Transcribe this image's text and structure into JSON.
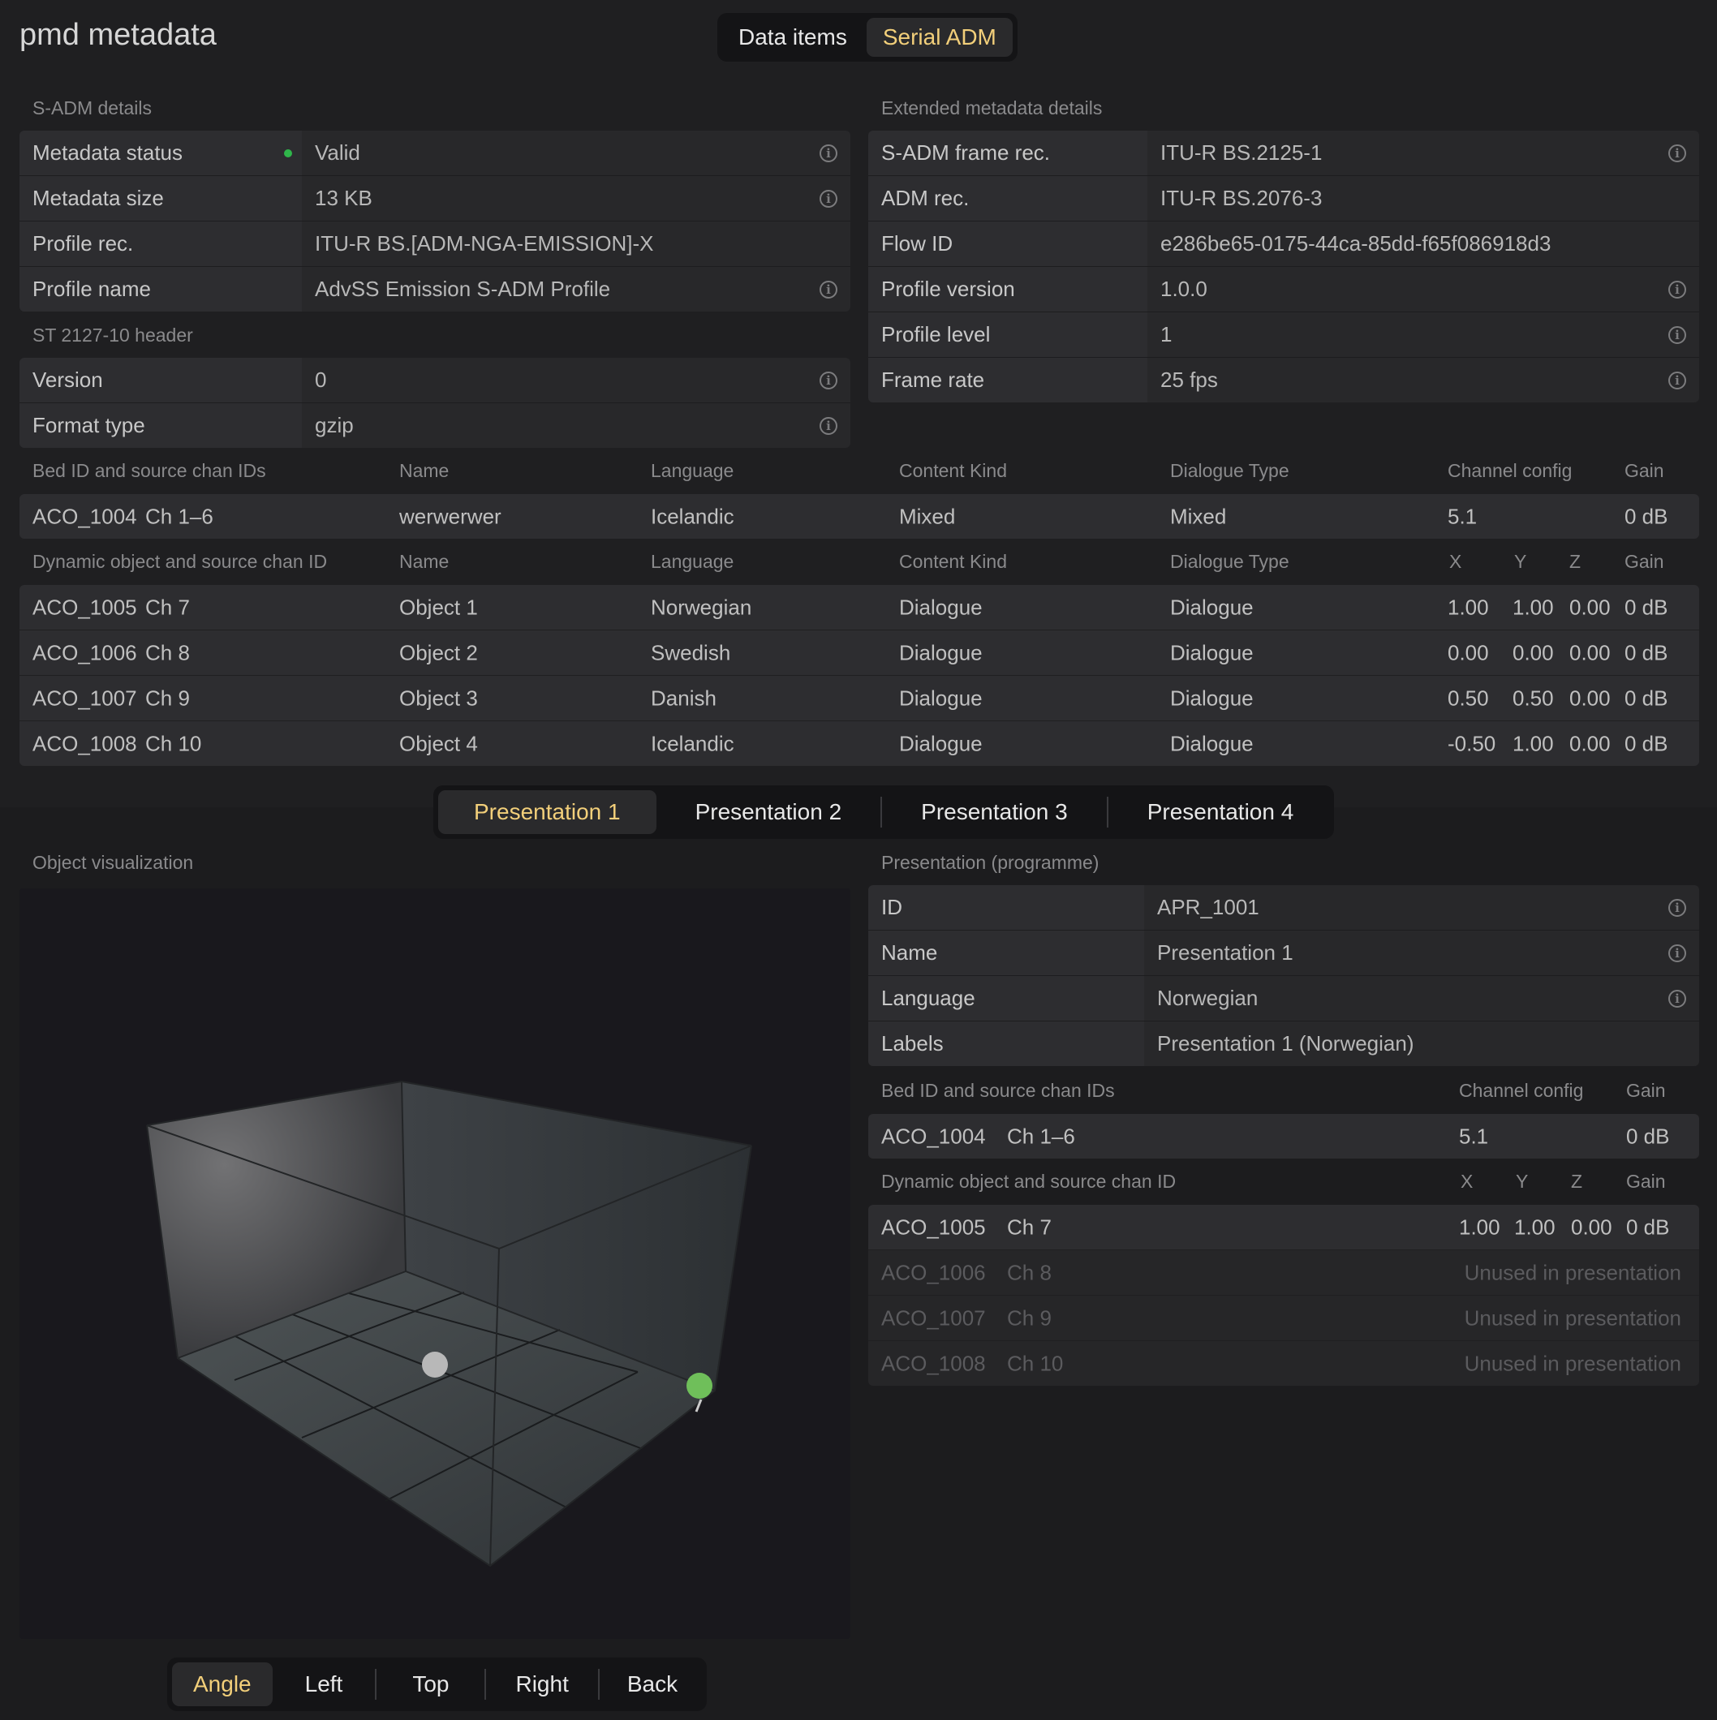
{
  "app_title": "pmd metadata",
  "top_tabs": [
    "Data items",
    "Serial ADM"
  ],
  "sadm": {
    "label": "S-ADM details",
    "rows": [
      {
        "key": "Metadata status",
        "value": "Valid"
      },
      {
        "key": "Metadata size",
        "value": "13 KB"
      },
      {
        "key": "Profile rec.",
        "value": "ITU-R BS.[ADM-NGA-EMISSION]-X"
      },
      {
        "key": "Profile name",
        "value": "AdvSS Emission S-ADM Profile"
      }
    ]
  },
  "st_header": {
    "label": "ST 2127-10 header",
    "rows": [
      {
        "key": "Version",
        "value": "0"
      },
      {
        "key": "Format type",
        "value": "gzip"
      }
    ]
  },
  "extended": {
    "label": "Extended metadata details",
    "rows": [
      {
        "key": "S-ADM frame rec.",
        "value": "ITU-R BS.2125-1"
      },
      {
        "key": "ADM rec.",
        "value": "ITU-R BS.2076-3"
      },
      {
        "key": "Flow ID",
        "value": "e286be65-0175-44ca-85dd-f65f086918d3"
      },
      {
        "key": "Profile version",
        "value": "1.0.0"
      },
      {
        "key": "Profile level",
        "value": "1"
      },
      {
        "key": "Frame rate",
        "value": "25 fps"
      }
    ]
  },
  "bed_table": {
    "headers": {
      "id": "Bed ID and source chan IDs",
      "name": "Name",
      "language": "Language",
      "content_kind": "Content Kind",
      "dialogue_type": "Dialogue Type",
      "channel_config": "Channel config",
      "gain": "Gain"
    },
    "rows": [
      {
        "id": "ACO_1004",
        "ch": "Ch 1–6",
        "name": "werwerwer",
        "language": "Icelandic",
        "content_kind": "Mixed",
        "dialogue_type": "Mixed",
        "channel_config": "5.1",
        "gain": "0 dB"
      }
    ]
  },
  "object_table": {
    "headers": {
      "id": "Dynamic object and source chan ID",
      "name": "Name",
      "language": "Language",
      "content_kind": "Content Kind",
      "dialogue_type": "Dialogue Type",
      "x": "X",
      "y": "Y",
      "z": "Z",
      "gain": "Gain"
    },
    "rows": [
      {
        "id": "ACO_1005",
        "ch": "Ch 7",
        "name": "Object 1",
        "language": "Norwegian",
        "content_kind": "Dialogue",
        "dialogue_type": "Dialogue",
        "x": "1.00",
        "y": "1.00",
        "z": "0.00",
        "gain": "0 dB"
      },
      {
        "id": "ACO_1006",
        "ch": "Ch 8",
        "name": "Object 2",
        "language": "Swedish",
        "content_kind": "Dialogue",
        "dialogue_type": "Dialogue",
        "x": "0.00",
        "y": "0.00",
        "z": "0.00",
        "gain": "0 dB"
      },
      {
        "id": "ACO_1007",
        "ch": "Ch 9",
        "name": "Object 3",
        "language": "Danish",
        "content_kind": "Dialogue",
        "dialogue_type": "Dialogue",
        "x": "0.50",
        "y": "0.50",
        "z": "0.00",
        "gain": "0 dB"
      },
      {
        "id": "ACO_1008",
        "ch": "Ch 10",
        "name": "Object 4",
        "language": "Icelandic",
        "content_kind": "Dialogue",
        "dialogue_type": "Dialogue",
        "x": "-0.50",
        "y": "1.00",
        "z": "0.00",
        "gain": "0 dB"
      }
    ]
  },
  "presentation_tabs": [
    "Presentation 1",
    "Presentation 2",
    "Presentation 3",
    "Presentation 4"
  ],
  "object_viz_label": "Object visualization",
  "view_buttons": [
    "Angle",
    "Left",
    "Top",
    "Right",
    "Back"
  ],
  "presentation": {
    "label": "Presentation (programme)",
    "rows": [
      {
        "key": "ID",
        "value": "APR_1001"
      },
      {
        "key": "Name",
        "value": "Presentation 1"
      },
      {
        "key": "Language",
        "value": "Norwegian"
      },
      {
        "key": "Labels",
        "value": "Presentation 1 (Norwegian)"
      }
    ],
    "bed_headers": {
      "id": "Bed ID and source chan IDs",
      "channel_config": "Channel config",
      "gain": "Gain"
    },
    "bed_rows": [
      {
        "id": "ACO_1004",
        "ch": "Ch 1–6",
        "channel_config": "5.1",
        "gain": "0 dB"
      }
    ],
    "obj_headers": {
      "id": "Dynamic object and source chan ID",
      "x": "X",
      "y": "Y",
      "z": "Z",
      "gain": "Gain"
    },
    "obj_rows": [
      {
        "id": "ACO_1005",
        "ch": "Ch 7",
        "x": "1.00",
        "y": "1.00",
        "z": "0.00",
        "gain": "0 dB",
        "unused": ""
      },
      {
        "id": "ACO_1006",
        "ch": "Ch 8",
        "unused": "Unused in presentation"
      },
      {
        "id": "ACO_1007",
        "ch": "Ch 9",
        "unused": "Unused in presentation"
      },
      {
        "id": "ACO_1008",
        "ch": "Ch 10",
        "unused": "Unused in presentation"
      }
    ]
  },
  "colors": {
    "accent": "#f2cf7a",
    "status_ok": "#2fb64a",
    "object_active": "#6fbf5a",
    "object_inactive": "#b8b8b8"
  }
}
